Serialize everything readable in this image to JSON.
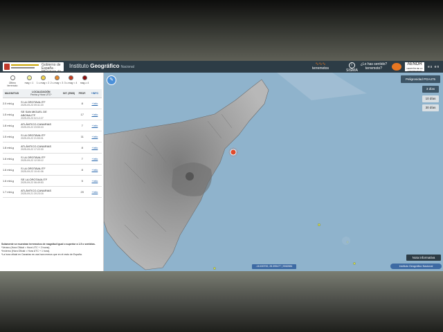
{
  "header": {
    "gov_text": "Gobierno de España · Ministerio de Transportes",
    "title_prefix": "Instituto ",
    "title_bold": "Geográfico",
    "title_suffix": "Nacional",
    "terremotos_label": "terremotos",
    "info_label": "SISMIA",
    "sentido_label": "¿Lo has sentido? terremoto?",
    "aenor_label": "AENOR",
    "aenor_sub": "GESTIÓN DE LA CONTINUIDAD",
    "lang": "es en"
  },
  "legend": {
    "items": [
      {
        "label": "Último terremoto",
        "color": "#ffffff"
      },
      {
        "label": "mag < 1",
        "color": "#f5f5a0"
      },
      {
        "label": "1 ≤ mag < 2",
        "color": "#f2d24a"
      },
      {
        "label": "2 ≤ mag < 3",
        "color": "#e8892b"
      },
      {
        "label": "3 ≤ mag < 4",
        "color": "#c43a1f"
      },
      {
        "label": "mag ≥ 4",
        "color": "#8b0d0d"
      }
    ]
  },
  "table": {
    "headers": {
      "magnitude": "MAGNITUD",
      "location": "LOCALIZACIÓN",
      "location_sub": "Fecha y Hora UTC*",
      "intensity": "INT. (EMS)",
      "depth": "PROF.",
      "more": "+INFO"
    },
    "rows": [
      {
        "mag": "2.0 mbLg",
        "place": "S LA OROTAVA.ITF",
        "date": "2025-09-23 09:41:20",
        "int": "",
        "depth": "8",
        "more": "+info"
      },
      {
        "mag": "1.5 mbLg",
        "place": "SE SAN MIGUEL DE ABONA.ITF",
        "date": "2025-09-23 02:12:27",
        "int": "",
        "depth": "17",
        "more": "+info"
      },
      {
        "mag": "1.8 mbLg",
        "place": "ATLÁNTICO-CANARIAS",
        "date": "2025-09-22 23:50:24",
        "int": "",
        "depth": "7",
        "more": "+info"
      },
      {
        "mag": "1.5 mbLg",
        "place": "S LA OROTAVA.ITF",
        "date": "2025-09-22 21:53:01",
        "int": "",
        "depth": "11",
        "more": "+info"
      },
      {
        "mag": "1.8 mbLg",
        "place": "ATLÁNTICO-CANARIAS",
        "date": "2025-09-22 17:22:30",
        "int": "",
        "depth": "8",
        "more": "+info"
      },
      {
        "mag": "1.6 mbLg",
        "place": "S LA OROTAVA.ITF",
        "date": "2025-09-22 12:30:12",
        "int": "",
        "depth": "7",
        "more": "+info"
      },
      {
        "mag": "1.6 mbLg",
        "place": "S LA OROTAVA.ITF",
        "date": "2025-09-22 10:41:06",
        "int": "",
        "depth": "8",
        "more": "+info"
      },
      {
        "mag": "1.6 mbLg",
        "place": "SE LA OROTAVA.ITF",
        "date": "2025-09-22 06:49:53",
        "int": "",
        "depth": "5",
        "more": "+info"
      },
      {
        "mag": "1.7 mbLg",
        "place": "ATLÁNTICO-CANARIAS",
        "date": "2025-09-21 20:23:16",
        "int": "",
        "depth": "20",
        "more": "+info"
      }
    ]
  },
  "notes": {
    "line1": "Solamente se muestran terremotos de magnitud igual o superior a 1.5 o sentidos.",
    "line2": "*Verano (Hora Oficial = Hora UTC + 2 horas).",
    "line3": "*Invierno (Hora Oficial = Hora UTC + 1 hora).",
    "line4": "*La hora oficial en Canarias es una hora menos que en el resto de España."
  },
  "map": {
    "pga_label": "Peligrosidad PGA475",
    "days": [
      "3 días",
      "10 días",
      "30 días"
    ],
    "nota_label": "Nota informativa",
    "ign_label": "Instituto Geográfico Nacional",
    "coords_text": "-16.630700, 28.395477 | 9062884",
    "island_color": "#9a9a9a",
    "sea_color": "#8fb3cc"
  }
}
